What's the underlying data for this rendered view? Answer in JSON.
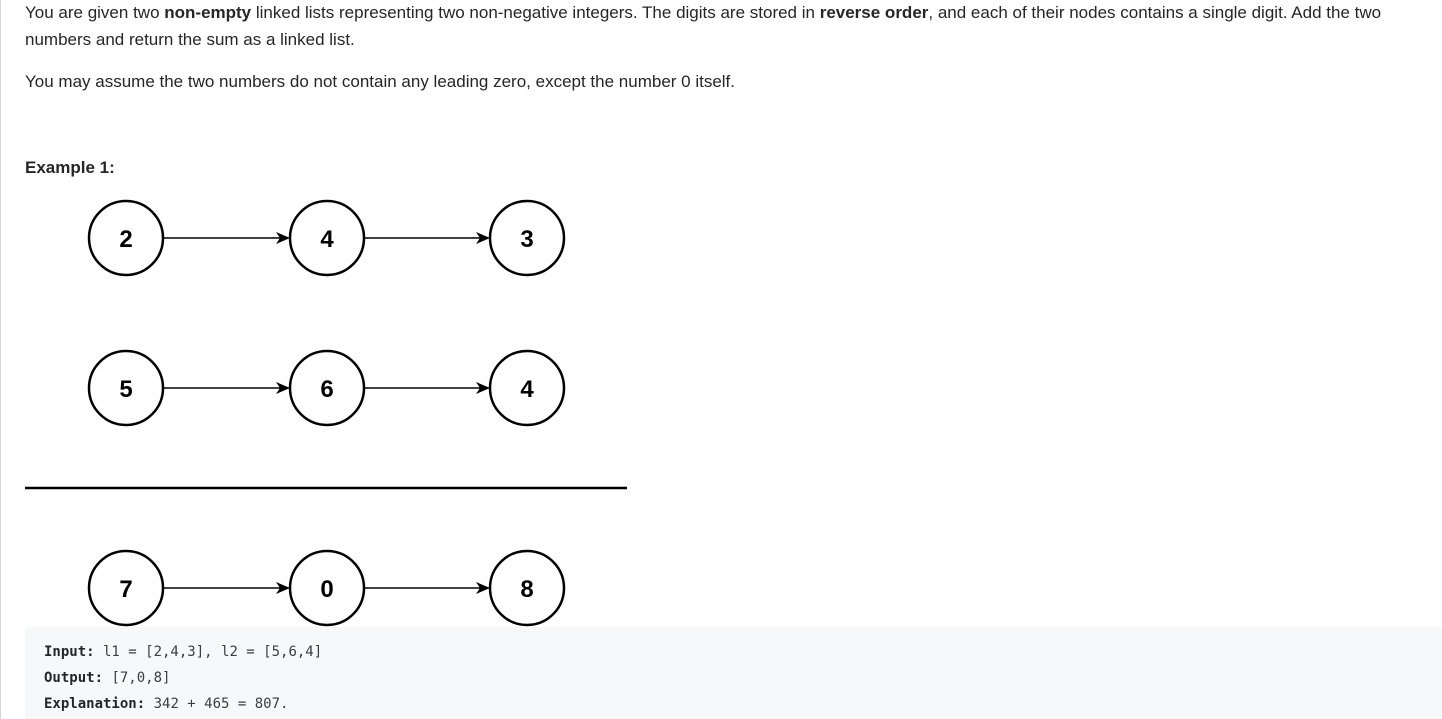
{
  "description": {
    "p1_a": "You are given two ",
    "p1_b": "non-empty",
    "p1_c": " linked lists representing two non-negative integers. The digits are stored in ",
    "p1_d": "reverse order",
    "p1_e": ", and each of their nodes contains a single digit. Add the two numbers and return the sum as a linked list.",
    "p2": "You may assume the two numbers do not contain any leading zero, except the number 0 itself."
  },
  "example": {
    "heading": "Example 1:",
    "lists": {
      "l1": [
        "2",
        "4",
        "3"
      ],
      "l2": [
        "5",
        "6",
        "4"
      ],
      "result": [
        "7",
        "0",
        "8"
      ]
    },
    "code": {
      "input_label": "Input:",
      "input_value": " l1 = [2,4,3], l2 = [5,6,4]",
      "output_label": "Output:",
      "output_value": " [7,0,8]",
      "explanation_label": "Explanation:",
      "explanation_value": " 342 + 465 = 807."
    }
  }
}
